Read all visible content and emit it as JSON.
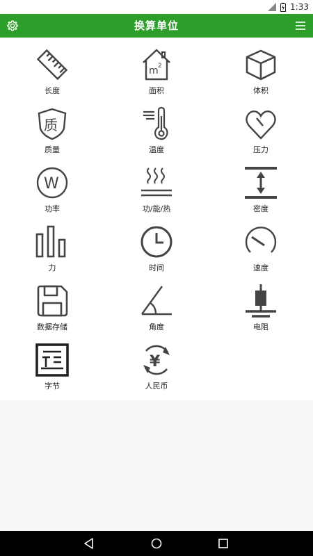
{
  "status_bar": {
    "time": "1:33"
  },
  "app_bar": {
    "title": "换算单位",
    "settings_icon": "gear-icon",
    "menu_icon": "menu-icon"
  },
  "units": [
    {
      "label": "长度",
      "icon": "ruler-icon"
    },
    {
      "label": "面积",
      "icon": "area-house-icon"
    },
    {
      "label": "体积",
      "icon": "cube-icon"
    },
    {
      "label": "质量",
      "icon": "mass-shield-icon"
    },
    {
      "label": "温度",
      "icon": "thermometer-icon"
    },
    {
      "label": "压力",
      "icon": "pressure-heart-icon"
    },
    {
      "label": "功率",
      "icon": "power-w-icon"
    },
    {
      "label": "功/能/热",
      "icon": "heat-waves-icon"
    },
    {
      "label": "密度",
      "icon": "density-icon"
    },
    {
      "label": "力",
      "icon": "force-bars-icon"
    },
    {
      "label": "时间",
      "icon": "clock-icon"
    },
    {
      "label": "速度",
      "icon": "speedometer-icon"
    },
    {
      "label": "数据存储",
      "icon": "floppy-disk-icon"
    },
    {
      "label": "角度",
      "icon": "angle-icon"
    },
    {
      "label": "电阻",
      "icon": "resistor-icon"
    },
    {
      "label": "字节",
      "icon": "byte-icon"
    },
    {
      "label": "人民币",
      "icon": "yuan-icon"
    }
  ],
  "colors": {
    "app_bar": "#2e9e2a",
    "icon_stroke": "#444444",
    "background": "#f7f7f9"
  }
}
